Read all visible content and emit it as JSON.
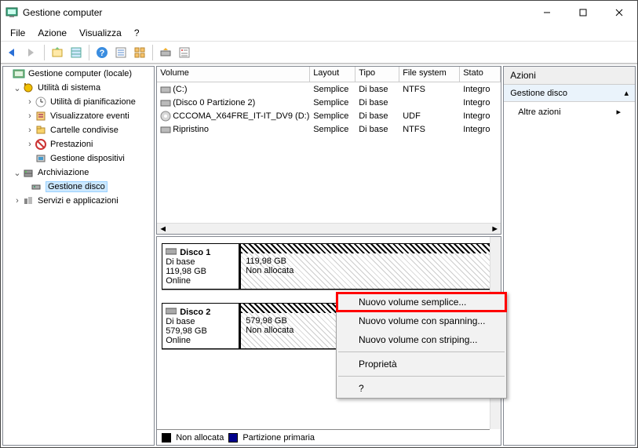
{
  "window": {
    "title": "Gestione computer"
  },
  "menubar": [
    "File",
    "Azione",
    "Visualizza",
    "?"
  ],
  "tree": {
    "root": "Gestione computer (locale)",
    "sys": "Utilità di sistema",
    "sys_children": [
      "Utilità di pianificazione",
      "Visualizzatore eventi",
      "Cartelle condivise",
      "Prestazioni",
      "Gestione dispositivi"
    ],
    "arch": "Archiviazione",
    "disk_mgmt": "Gestione disco",
    "srv": "Servizi e applicazioni"
  },
  "table": {
    "headers": {
      "vol": "Volume",
      "lay": "Layout",
      "tip": "Tipo",
      "fs": "File system",
      "sta": "Stato"
    },
    "rows": [
      {
        "vol": "(C:)",
        "lay": "Semplice",
        "tip": "Di base",
        "fs": "NTFS",
        "sta": "Integro"
      },
      {
        "vol": "(Disco 0 Partizione 2)",
        "lay": "Semplice",
        "tip": "Di base",
        "fs": "",
        "sta": "Integro"
      },
      {
        "vol": "CCCOMA_X64FRE_IT-IT_DV9 (D:)",
        "lay": "Semplice",
        "tip": "Di base",
        "fs": "UDF",
        "sta": "Integro"
      },
      {
        "vol": "Ripristino",
        "lay": "Semplice",
        "tip": "Di base",
        "fs": "NTFS",
        "sta": "Integro"
      }
    ]
  },
  "disks": {
    "d1": {
      "name": "Disco 1",
      "type": "Di base",
      "size": "119,98 GB",
      "status": "Online",
      "psize": "119,98 GB",
      "pstatus": "Non allocata"
    },
    "d2": {
      "name": "Disco 2",
      "type": "Di base",
      "size": "579,98 GB",
      "status": "Online",
      "psize": "579,98 GB",
      "pstatus": "Non allocata"
    }
  },
  "legend": {
    "unalloc": "Non allocata",
    "primary": "Partizione primaria"
  },
  "actions": {
    "head": "Azioni",
    "sub": "Gestione disco",
    "more": "Altre azioni"
  },
  "ctx": {
    "simple": "Nuovo volume semplice...",
    "span": "Nuovo volume con spanning...",
    "stripe": "Nuovo volume con striping...",
    "prop": "Proprietà",
    "help": "?"
  }
}
